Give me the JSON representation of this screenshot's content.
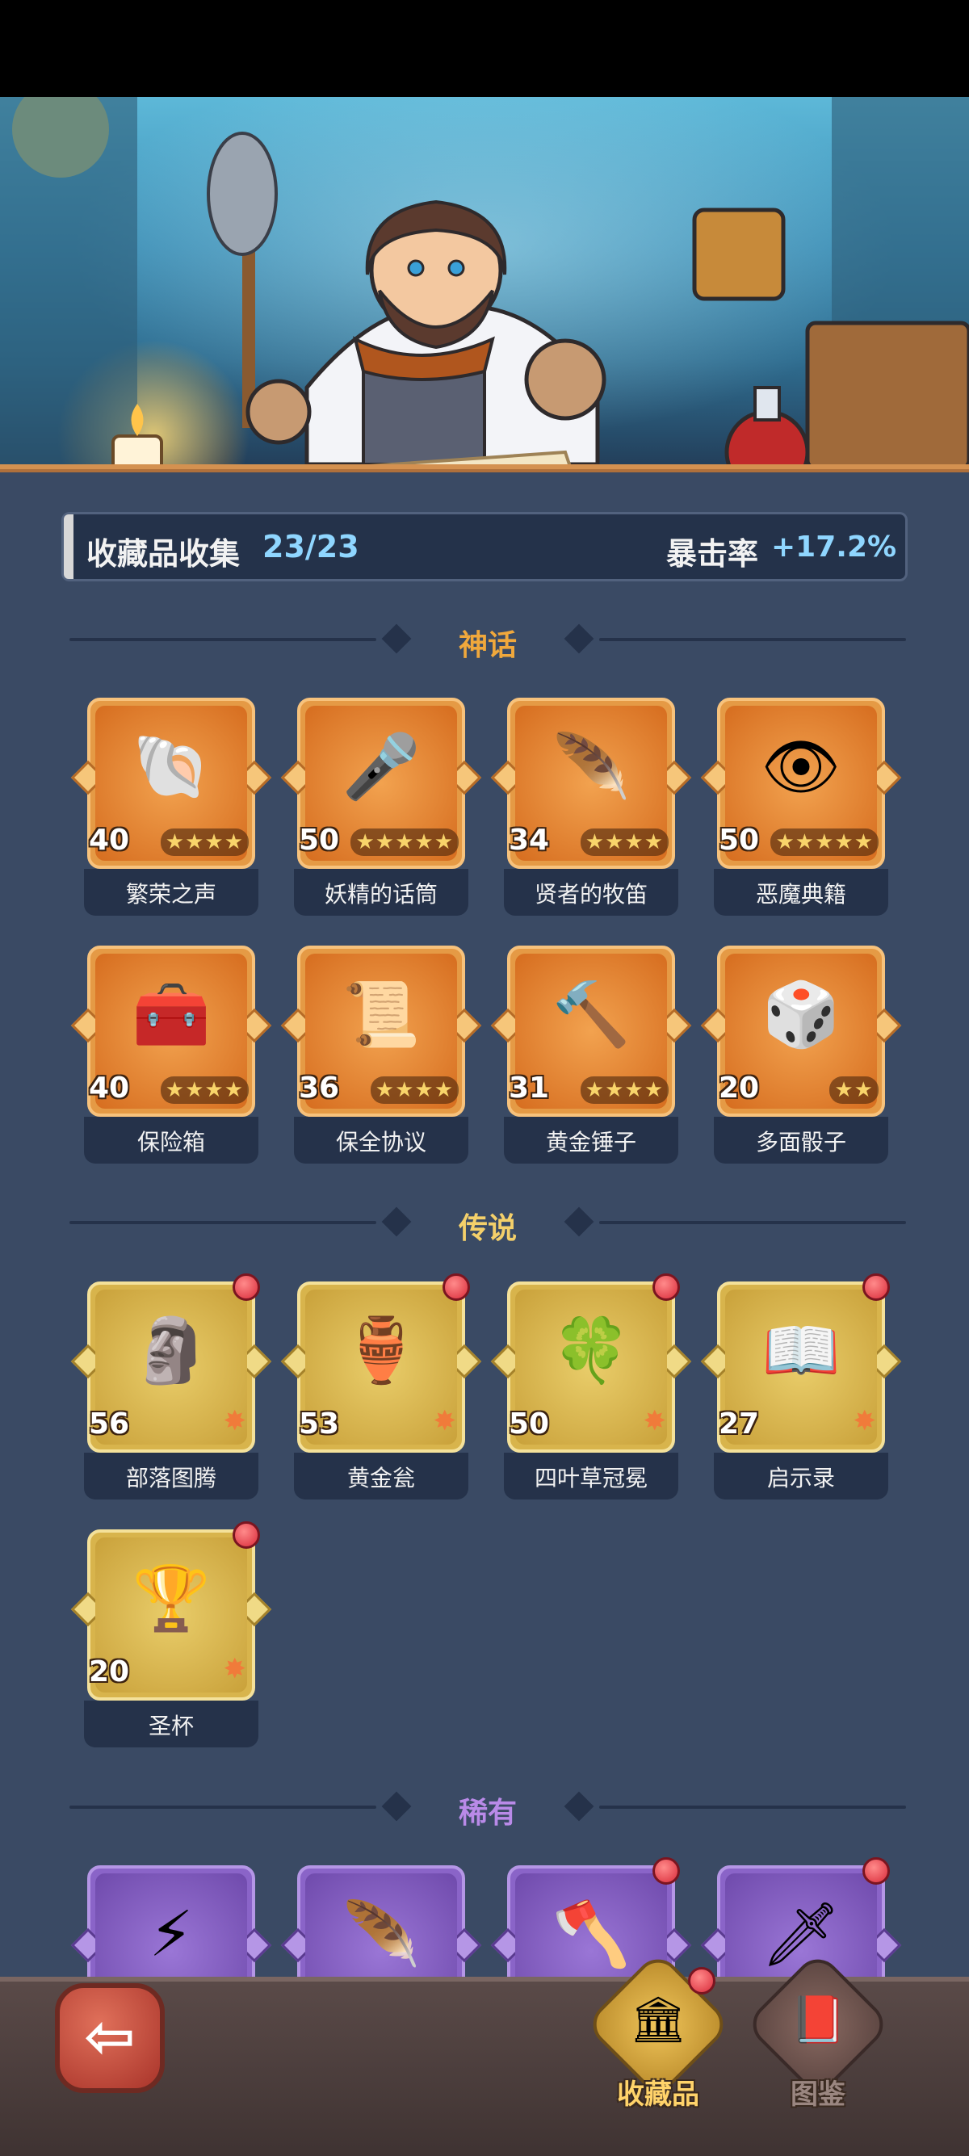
{
  "summary": {
    "collection_label": "收藏品收集",
    "collection_count": "23/23",
    "crit_label": "暴击率",
    "crit_value": "+17.2%"
  },
  "sections": {
    "mythic": {
      "title": "神话",
      "color": "#f0a83c"
    },
    "legend": {
      "title": "传说",
      "color": "#f4d06a"
    },
    "rare": {
      "title": "稀有",
      "color": "#b98ae8"
    }
  },
  "mythic_items": [
    {
      "level": "40",
      "stars": "★★★★",
      "name": "繁荣之声",
      "icon": "🐚"
    },
    {
      "level": "50",
      "stars": "★★★★★",
      "name": "妖精的话筒",
      "icon": "🎤"
    },
    {
      "level": "34",
      "stars": "★★★★",
      "name": "贤者的牧笛",
      "icon": "🪶"
    },
    {
      "level": "50",
      "stars": "★★★★★",
      "name": "恶魔典籍",
      "icon": "👁"
    },
    {
      "level": "40",
      "stars": "★★★★",
      "name": "保险箱",
      "icon": "🧰"
    },
    {
      "level": "36",
      "stars": "★★★★",
      "name": "保全协议",
      "icon": "📜"
    },
    {
      "level": "31",
      "stars": "★★★★",
      "name": "黄金锤子",
      "icon": "🔨"
    },
    {
      "level": "20",
      "stars": "★★",
      "name": "多面骰子",
      "icon": "🎲"
    }
  ],
  "legend_items": [
    {
      "level": "56",
      "star": "✸",
      "name": "部落图腾",
      "icon": "🗿"
    },
    {
      "level": "53",
      "star": "✸",
      "name": "黄金瓮",
      "icon": "🏺"
    },
    {
      "level": "50",
      "star": "✸",
      "name": "四叶草冠冕",
      "icon": "🍀"
    },
    {
      "level": "27",
      "star": "✸",
      "name": "启示录",
      "icon": "📖"
    },
    {
      "level": "20",
      "star": "✸",
      "name": "圣杯",
      "icon": "🏆"
    }
  ],
  "rare_items": [
    {
      "icon": "⚡"
    },
    {
      "icon": "🪶"
    },
    {
      "icon": "🪓"
    },
    {
      "icon": "🗡"
    }
  ],
  "nav": {
    "back_icon": "⇦",
    "collection_label": "收藏品",
    "collection_icon": "🏛",
    "codex_label": "图鉴",
    "codex_icon": "📕"
  }
}
